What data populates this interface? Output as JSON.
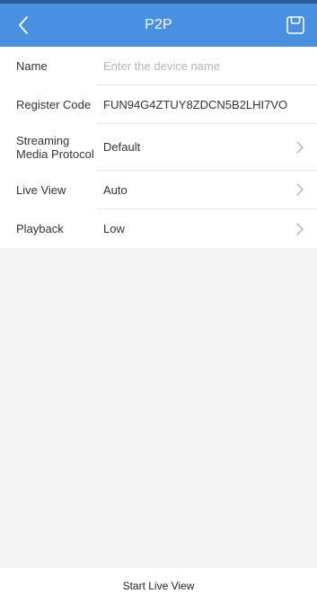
{
  "header": {
    "title": "P2P"
  },
  "form": {
    "name": {
      "label": "Name",
      "value": "",
      "placeholder": "Enter the device name"
    },
    "register_code": {
      "label": "Register Code",
      "value": "FUN94G4ZTUY8ZDCN5B2LHI7VO"
    },
    "streaming_protocol": {
      "label_line1": "Streaming",
      "label_line2": "Media Protocol",
      "value": "Default"
    },
    "live_view": {
      "label": "Live View",
      "value": "Auto"
    },
    "playback": {
      "label": "Playback",
      "value": "Low"
    }
  },
  "footer": {
    "start_label": "Start Live View"
  },
  "colors": {
    "header": "#4a90e2",
    "header_top": "#2a5b95",
    "background": "#f4f4f4"
  },
  "icons": {
    "back": "chevron-left-icon",
    "save": "save-icon",
    "row_arrow": "chevron-right-icon"
  }
}
